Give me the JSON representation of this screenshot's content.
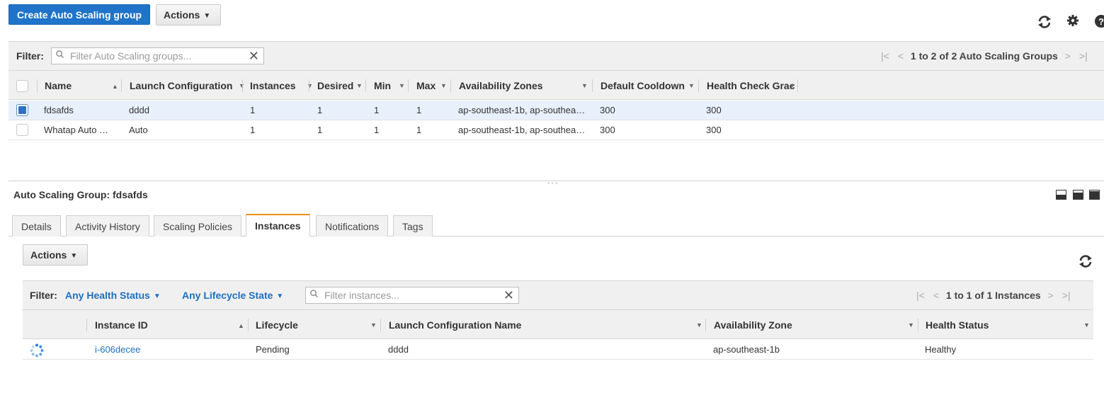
{
  "toolbar": {
    "create_label": "Create Auto Scaling group",
    "actions_label": "Actions",
    "refresh_icon": "refresh-icon",
    "settings_icon": "gear-icon",
    "help_icon": "help-icon"
  },
  "filter": {
    "label": "Filter:",
    "placeholder": "Filter Auto Scaling groups...",
    "pager_text": "1 to 2 of 2 Auto Scaling Groups"
  },
  "groups_table": {
    "columns": [
      "Name",
      "Launch Configuration",
      "Instances",
      "Desired",
      "Min",
      "Max",
      "Availability Zones",
      "Default Cooldown",
      "Health Check Grac"
    ],
    "rows": [
      {
        "selected": true,
        "cells": [
          "fdsafds",
          "dddd",
          "1",
          "1",
          "1",
          "1",
          "ap-southeast-1b, ap-southea…",
          "300",
          "300"
        ]
      },
      {
        "selected": false,
        "cells": [
          "Whatap Auto …",
          "Auto",
          "1",
          "1",
          "1",
          "1",
          "ap-southeast-1b, ap-southea…",
          "300",
          "300"
        ]
      }
    ]
  },
  "detail": {
    "title": "Auto Scaling Group: fdsafds",
    "tabs": [
      "Details",
      "Activity History",
      "Scaling Policies",
      "Instances",
      "Notifications",
      "Tags"
    ],
    "active_tab": "Instances",
    "actions_label": "Actions",
    "filter_label": "Filter:",
    "health_filter": "Any Health Status",
    "lifecycle_filter": "Any Lifecycle State",
    "search_placeholder": "Filter instances...",
    "pager_text": "1 to 1 of 1 Instances",
    "columns": [
      "Instance ID",
      "Lifecycle",
      "Launch Configuration Name",
      "Availability Zone",
      "Health Status"
    ],
    "rows": [
      {
        "status_icon": "pending-spinner-icon",
        "cells": [
          "i-606decee",
          "Pending",
          "dddd",
          "ap-southeast-1b",
          "Healthy"
        ]
      }
    ]
  },
  "colors": {
    "primary": "#1f74c9",
    "link": "#1d6fbf",
    "active_tab_accent": "#f29111",
    "selected_row": "#e8f0fb"
  }
}
